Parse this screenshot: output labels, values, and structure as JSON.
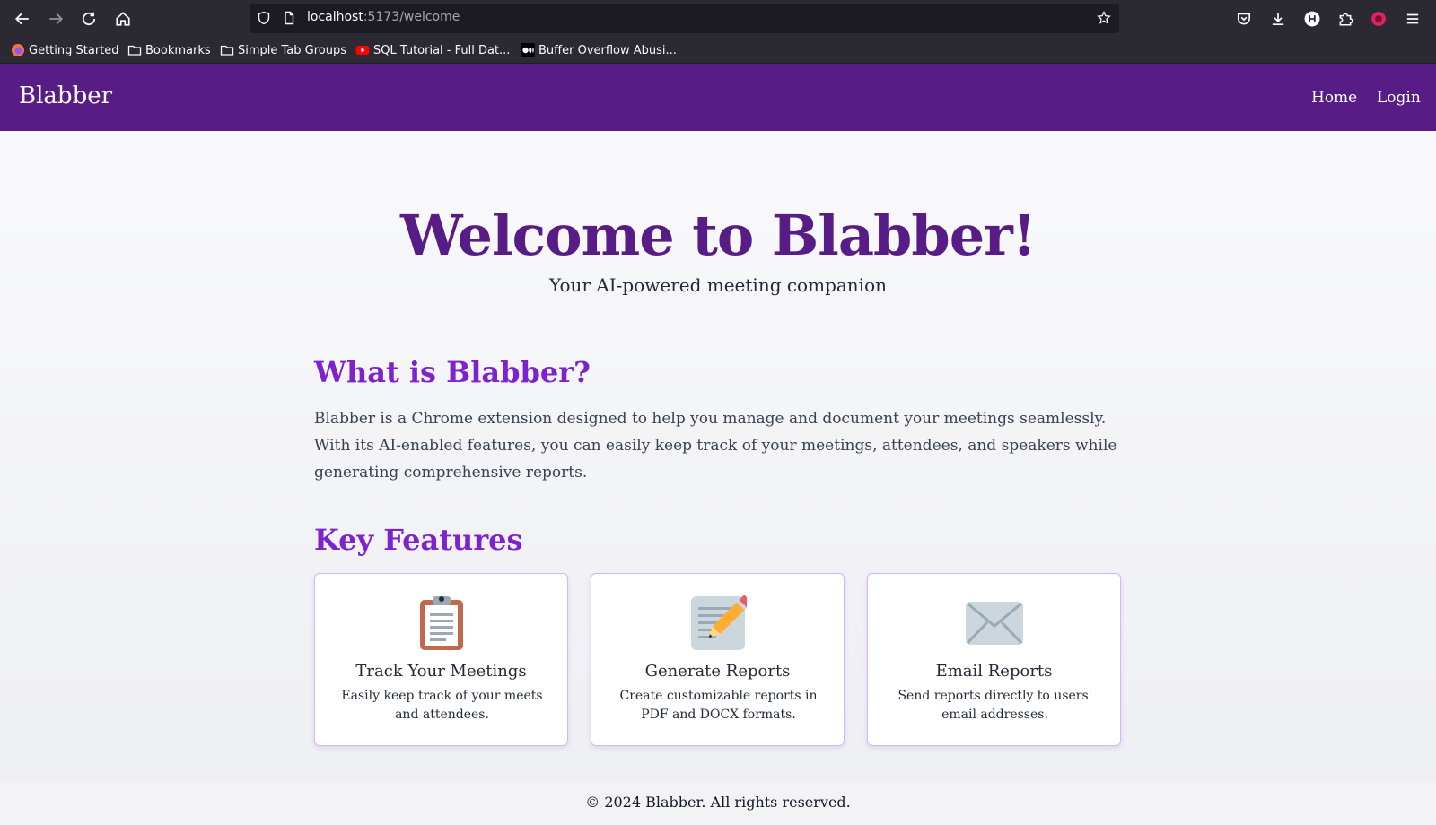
{
  "browser": {
    "url_host": "localhost",
    "url_path": ":5173/welcome",
    "bookmarks": [
      {
        "label": "Getting Started",
        "icon": "firefox-icon"
      },
      {
        "label": "Bookmarks",
        "icon": "folder-icon"
      },
      {
        "label": "Simple Tab Groups",
        "icon": "folder-icon"
      },
      {
        "label": "SQL Tutorial - Full Dat...",
        "icon": "youtube-icon"
      },
      {
        "label": "Buffer Overflow Abusi...",
        "icon": "medium-icon"
      }
    ]
  },
  "nav": {
    "brand": "Blabber",
    "links": [
      "Home",
      "Login"
    ]
  },
  "hero": {
    "title": "Welcome to Blabber!",
    "subtitle": "Your AI-powered meeting companion"
  },
  "about": {
    "heading": "What is Blabber?",
    "text": "Blabber is a Chrome extension designed to help you manage and document your meetings seamlessly. With its AI-enabled features, you can easily keep track of your meetings, attendees, and speakers while generating comprehensive reports."
  },
  "features": {
    "heading": "Key Features",
    "items": [
      {
        "icon": "clipboard-icon",
        "title": "Track Your Meetings",
        "description": "Easily keep track of your meets and attendees."
      },
      {
        "icon": "memo-pencil-icon",
        "title": "Generate Reports",
        "description": "Create customizable reports in PDF and DOCX formats."
      },
      {
        "icon": "envelope-icon",
        "title": "Email Reports",
        "description": "Send reports directly to users' email addresses."
      }
    ]
  },
  "footer": {
    "text": "© 2024 Blabber. All rights reserved."
  },
  "colors": {
    "brand_purple": "#581c87",
    "heading_purple": "#7e22ce",
    "card_border": "#d8b4fe"
  }
}
